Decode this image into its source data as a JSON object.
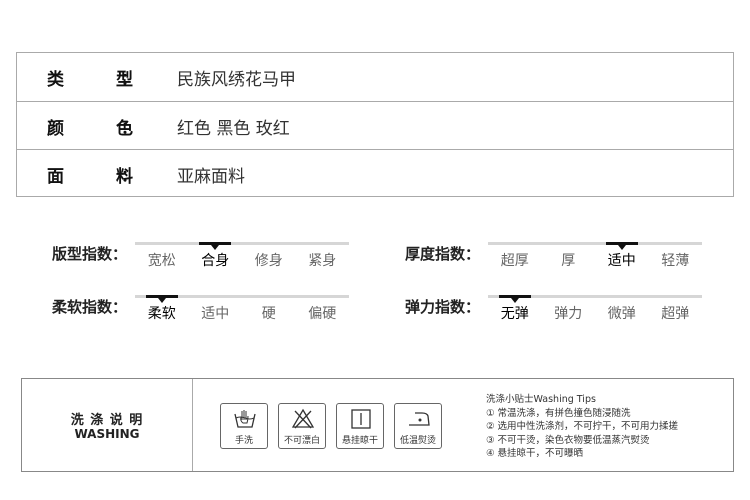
{
  "info": [
    {
      "label_chars": [
        "类",
        "型"
      ],
      "colon": "：",
      "value": "民族风绣花马甲"
    },
    {
      "label_chars": [
        "颜",
        "色"
      ],
      "colon": "：",
      "value": "红色 黑色 玫红"
    },
    {
      "label_chars": [
        "面",
        "料"
      ],
      "colon": "：",
      "value": "亚麻面料"
    }
  ],
  "scales": [
    {
      "title": "版型指数：",
      "options": [
        "宽松",
        "合身",
        "修身",
        "紧身"
      ],
      "selected_index": 1
    },
    {
      "title": "厚度指数：",
      "options": [
        "超厚",
        "厚",
        "适中",
        "轻薄"
      ],
      "selected_index": 2
    },
    {
      "title": "柔软指数：",
      "options": [
        "柔软",
        "适中",
        "硬",
        "偏硬"
      ],
      "selected_index": 0
    },
    {
      "title": "弹力指数：",
      "options": [
        "无弹",
        "弹力",
        "微弹",
        "超弹"
      ],
      "selected_index": 0
    }
  ],
  "washing": {
    "title_cn": "洗 涤 说 明",
    "title_en": "WASHING",
    "icons": [
      {
        "name": "hand-wash-icon",
        "label": "手洗"
      },
      {
        "name": "no-bleach-icon",
        "label": "不可漂白"
      },
      {
        "name": "hang-dry-icon",
        "label": "悬挂晾干"
      },
      {
        "name": "low-iron-icon",
        "label": "低温熨烫"
      }
    ],
    "tips_title": "洗涤小贴士Washing Tips",
    "tips": [
      "① 常温洗涤，有拼色撞色随浸随洗",
      "② 选用中性洗涤剂，不可拧干，不可用力揉搓",
      "③ 不可干烫，染色衣物要低温蒸汽熨烫",
      "④ 悬挂晾干，不可曝晒"
    ]
  }
}
